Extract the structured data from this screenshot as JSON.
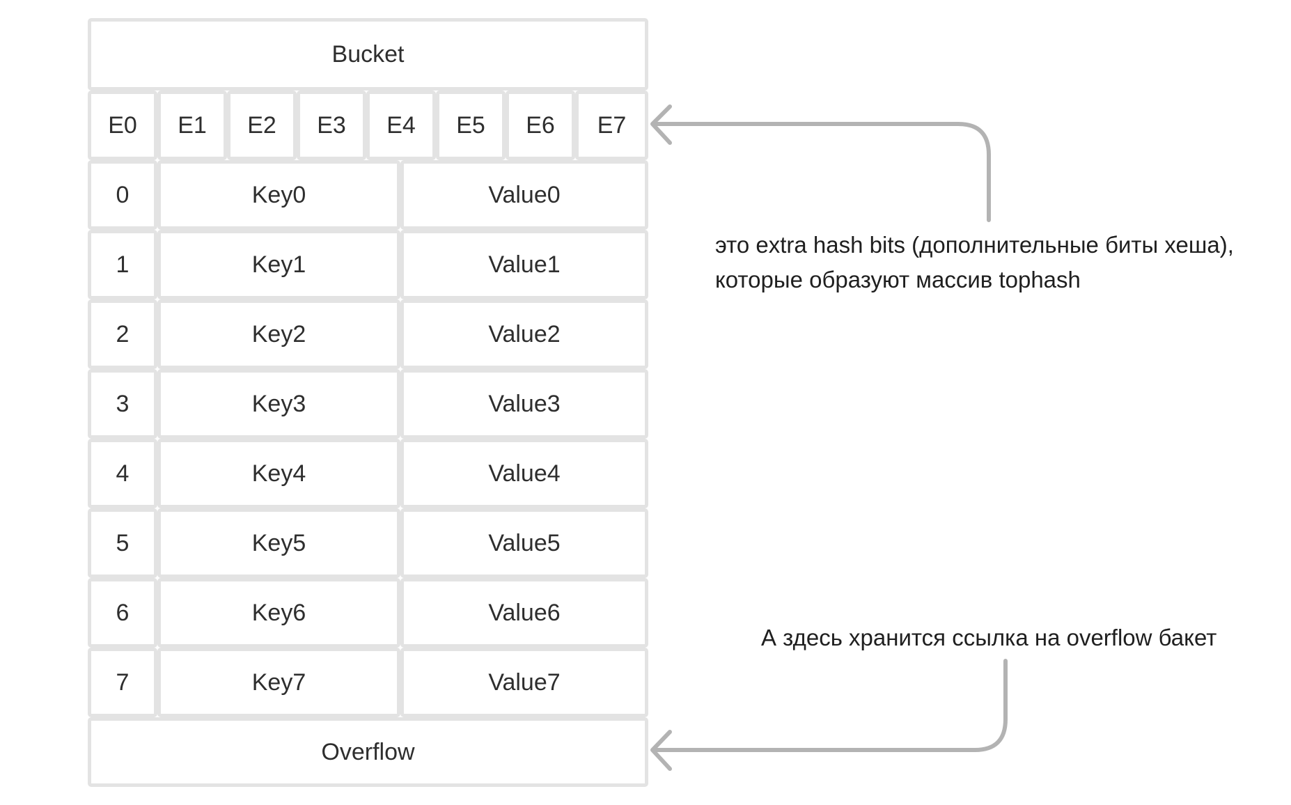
{
  "bucket": {
    "title": "Bucket",
    "tophash": [
      "E0",
      "E1",
      "E2",
      "E3",
      "E4",
      "E5",
      "E6",
      "E7"
    ],
    "rows": [
      {
        "index": "0",
        "key": "Key0",
        "value": "Value0"
      },
      {
        "index": "1",
        "key": "Key1",
        "value": "Value1"
      },
      {
        "index": "2",
        "key": "Key2",
        "value": "Value2"
      },
      {
        "index": "3",
        "key": "Key3",
        "value": "Value3"
      },
      {
        "index": "4",
        "key": "Key4",
        "value": "Value4"
      },
      {
        "index": "5",
        "key": "Key5",
        "value": "Value5"
      },
      {
        "index": "6",
        "key": "Key6",
        "value": "Value6"
      },
      {
        "index": "7",
        "key": "Key7",
        "value": "Value7"
      }
    ],
    "overflow": "Overflow"
  },
  "annotations": {
    "tophash_line1": "это extra hash bits (дополнительные биты хеша),",
    "tophash_line2": "которые образуют массив tophash",
    "overflow": "А здесь хранится ссылка на overflow бакет"
  },
  "colors": {
    "border": "#e3e3e3",
    "arrow": "#b3b3b3",
    "text": "#2e2e2e"
  }
}
